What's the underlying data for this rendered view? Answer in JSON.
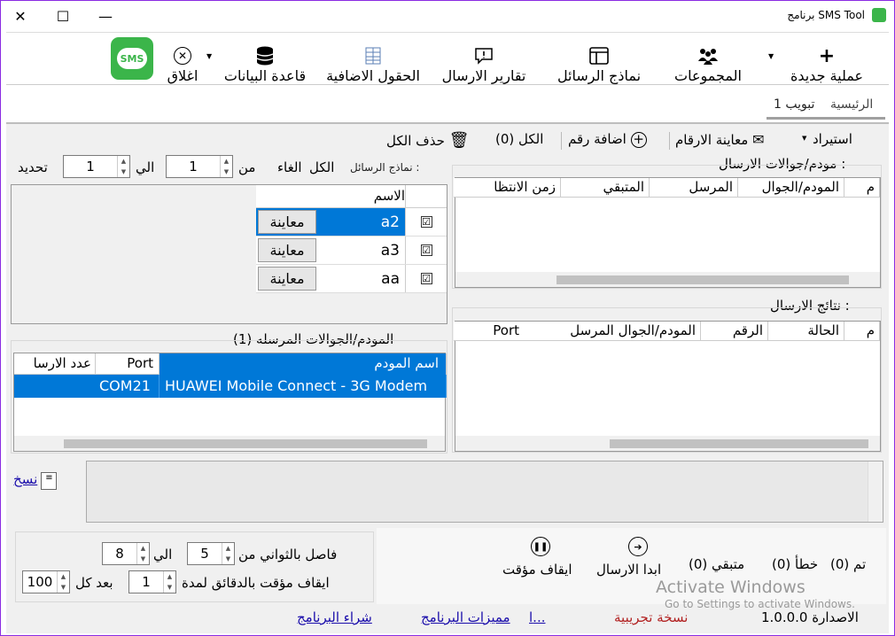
{
  "window": {
    "title": "برنامج SMS Tool",
    "minimize": "—",
    "maximize": "☐",
    "close": "✕"
  },
  "ribbon": {
    "new_op": "عملية جديدة",
    "groups": "المجموعات",
    "templates": "نماذج الرسائل",
    "reports": "تقارير الارسال",
    "extra_fields": "الحقول الاضافية",
    "database": "قاعدة البيانات",
    "close": "اغلاق",
    "logo_text": "SMS"
  },
  "tabs": {
    "home": "الرئيسية",
    "tab1": "تبويب 1"
  },
  "toolbar": {
    "import": "استيراد",
    "preview_numbers": "معاينة الارقام",
    "add_number": "اضافة رقم",
    "count_all": "(0) الكل",
    "delete_all": "حذف الكل"
  },
  "modems_panel": {
    "title": "مودم/جوالات الارسال :",
    "columns": [
      "م",
      "المودم/الجوال",
      "المرسل",
      "المتبقي",
      "زمن الانتظا"
    ]
  },
  "results_panel": {
    "title": "نتائج الارسال :",
    "columns": [
      "م",
      "الحالة",
      "الرقم",
      "المودم/الجوال المرسل",
      "Port"
    ]
  },
  "templates_panel": {
    "label": "نماذج الرسائل :",
    "all": "الكل",
    "cancel": "الغاء",
    "from": "من",
    "from_value": "1",
    "to": "الي",
    "to_value": "1",
    "select": "تحديد",
    "name_col": "الاسم",
    "preview_label": "معاينة",
    "rows": [
      {
        "checked": "☑",
        "name": "a2"
      },
      {
        "checked": "☑",
        "name": "a3"
      },
      {
        "checked": "☑",
        "name": "aa"
      }
    ]
  },
  "sending_modems": {
    "title": "المودم/الجوالات المرسله (1)",
    "columns": [
      "اسم المودم",
      "Port",
      "عدد الارسا"
    ],
    "rows": [
      {
        "name": "HUAWEI Mobile Connect - 3G Modem",
        "port": "COM21",
        "count": ""
      }
    ]
  },
  "log": {
    "copy": "نسخ"
  },
  "interval": {
    "seconds_label": "فاصل بالثواني من",
    "seconds_from": "5",
    "to": "الي",
    "seconds_to": "8",
    "pause_label": "ايقاف مؤقت بالدقائق لمدة",
    "pause_minutes": "1",
    "after": "بعد كل",
    "after_value": "100"
  },
  "status": {
    "done": "(0) تم",
    "errors": "(0) خطأ",
    "remaining": "(0) متبقي",
    "start": "ابدا الارسال",
    "pause": "ايقاف مؤقت"
  },
  "footer": {
    "version": "الاصدارة 1.0.0.0",
    "trial": "نسخة تجريبية",
    "partial_link": "ا...",
    "features": "مميزات البرنامج",
    "buy": "شراء البرنامج",
    "watermark_title": "Activate Windows",
    "watermark_sub": "Go to Settings to activate Windows."
  },
  "colors": {
    "selection": "#0078d7",
    "accent_logo": "#3bb54a",
    "trial_red": "#b22222",
    "link_blue": "#1a0dab"
  }
}
